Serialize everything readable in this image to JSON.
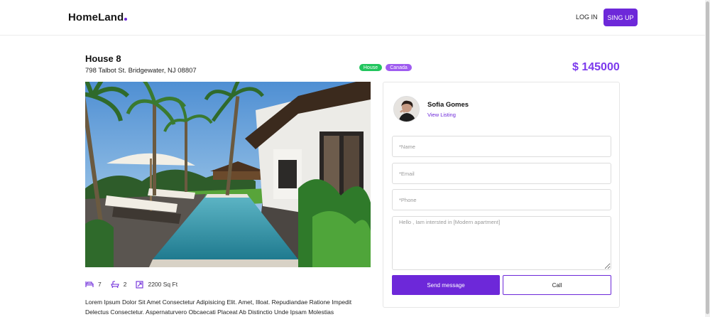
{
  "header": {
    "logo": "HomeLand",
    "login_label": "LOG IN",
    "signup_label": "SING UP",
    "accent_color": "#6d28d9"
  },
  "listing": {
    "title": "House 8",
    "address": "798 Talbot St. Bridgewater, NJ 08807",
    "tags": [
      "House",
      "Canada"
    ],
    "price": "$ 145000",
    "photo_icon": "villa-pool-photo",
    "features": {
      "beds": "7",
      "baths": "2",
      "area": "2200 Sq Ft"
    },
    "description": "Lorem Ipsum Dolor Sit Amet Consectetur Adipisicing Elit. Amet, Illoat. Repudiandae Ratione Impedit Delectus Consectetur. Aspernaturvero Obcaecati Placeat Ab Distinctio Unde Ipsam Molestias"
  },
  "contact": {
    "agent_name": "Sofia Gomes",
    "view_listing": "View Listing",
    "name_placeholder": "*Name",
    "email_placeholder": "*Email",
    "phone_placeholder": "*Phone",
    "message_placeholder": "Hello , Iam intersted in [Modern apartment]",
    "send_label": "Send message",
    "call_label": "Call"
  }
}
